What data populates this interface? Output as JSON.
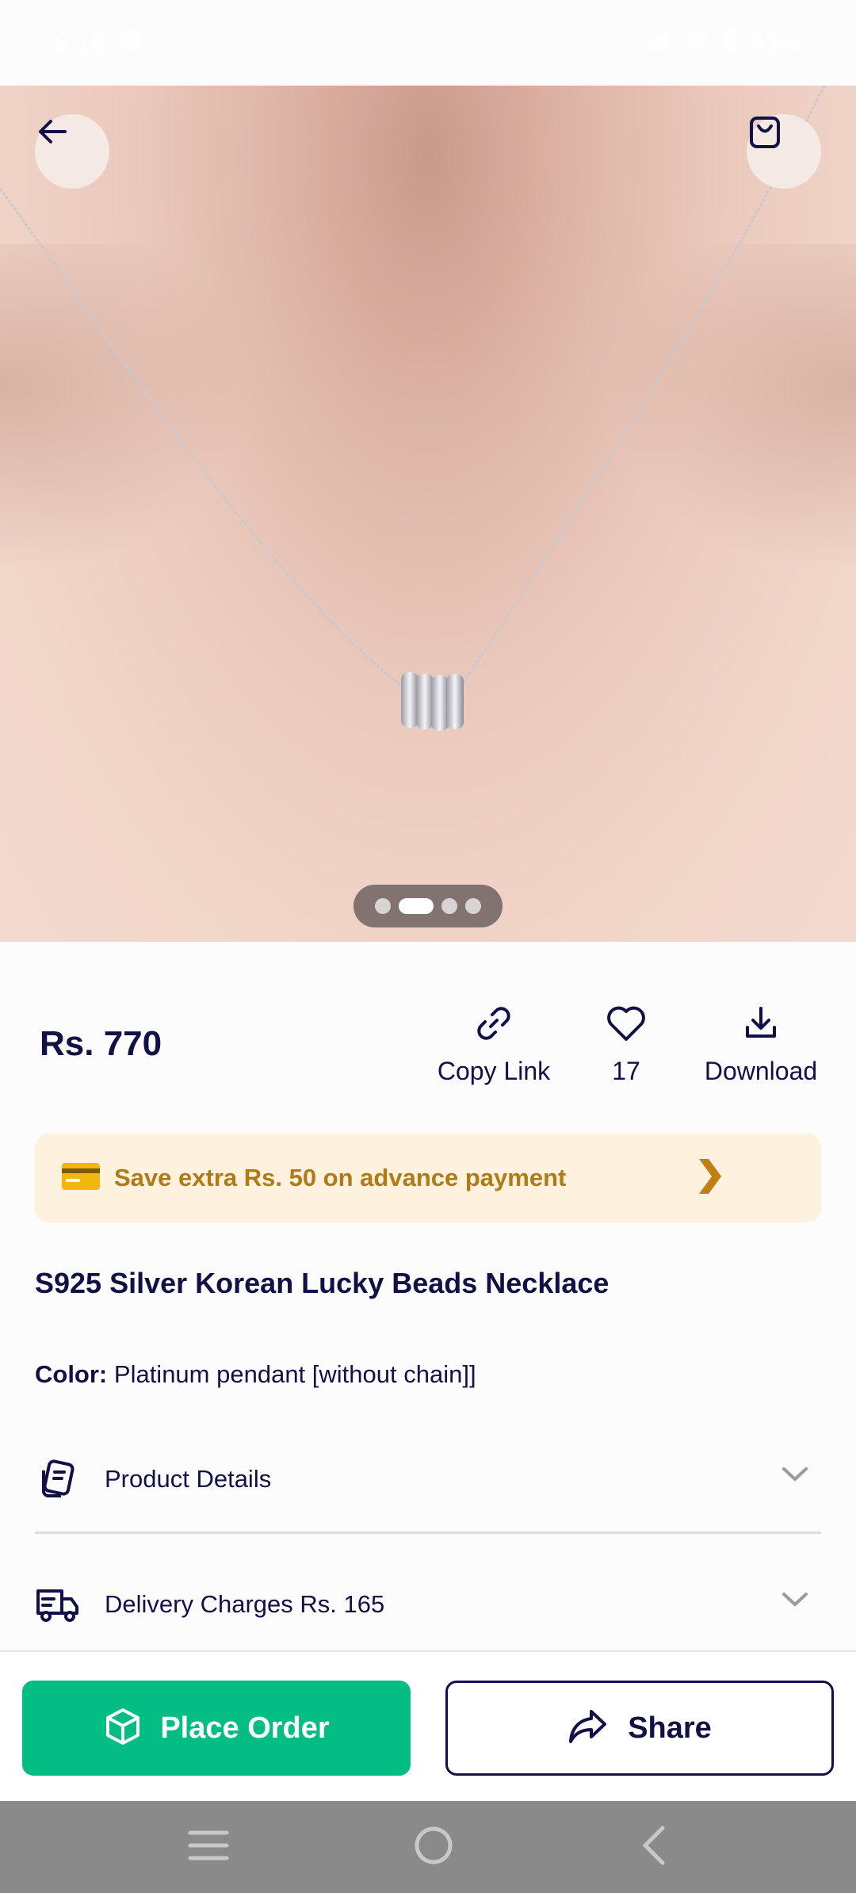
{
  "status_bar": {
    "time": "9:18",
    "battery": "93%"
  },
  "hero": {
    "image_alt": "silver necklace with bead pendant worn on neck",
    "pagination": {
      "count": 4,
      "active_index": 1
    }
  },
  "product": {
    "price": "Rs. 770",
    "title": "S925 Silver Korean Lucky Beads Necklace",
    "color_label": "Color:",
    "color_value": "Platinum pendant [without chain]]"
  },
  "actions": {
    "copy_link_label": "Copy Link",
    "likes_count": "17",
    "download_label": "Download"
  },
  "promo": {
    "text": "Save extra Rs. 50 on advance payment"
  },
  "accordion": [
    {
      "label": "Product Details",
      "icon": "document-icon"
    },
    {
      "label": "Delivery Charges Rs. 165",
      "icon": "delivery-truck-icon"
    }
  ],
  "bottom_buttons": {
    "place_order_label": "Place Order",
    "share_label": "Share"
  },
  "colors": {
    "brand_navy": "#111148",
    "order_green": "#03bd85",
    "promo_bg": "#fef1de",
    "promo_text": "#b07a14"
  }
}
